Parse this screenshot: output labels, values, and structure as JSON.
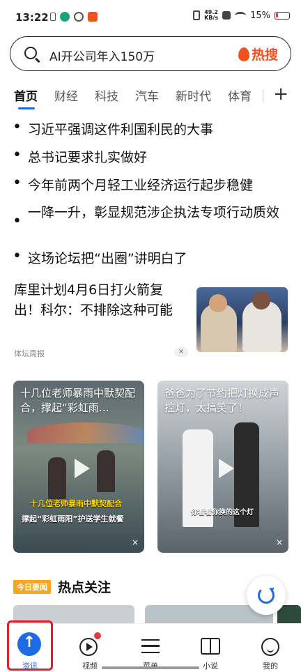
{
  "status_bar": {
    "time": "13:22",
    "network_speed_value": "49.2",
    "network_speed_unit": "KB/s",
    "battery": "15%"
  },
  "search": {
    "query": "AI开公司年入150万",
    "hot_label": "热搜"
  },
  "tabs": [
    "首页",
    "财经",
    "科技",
    "汽车",
    "新时代",
    "体育"
  ],
  "headlines": [
    "习近平强调这件利国利民的大事",
    "总书记要求扎实做好",
    "今年前两个月轻工业经济运行起步稳健",
    "一降一升，彰显规范涉企执法专项行动质效",
    "这场论坛把“出圈”讲明白了"
  ],
  "article": {
    "title": "库里计划4月6日打火箭复出！科尔：不排除这种可能",
    "source": "体坛周报",
    "close": "×"
  },
  "videos": [
    {
      "title": "十几位老师暴雨中默契配合，撑起“彩虹雨…",
      "caption_line1": "十几位老师暴雨中默契配合",
      "caption_line2": "撑起“彩虹雨阳”护送学生就餐",
      "close": "×"
    },
    {
      "title": "爸爸为了节约把灯换成声控灯，太搞笑了！",
      "caption_line1": "你看看你换的这个灯",
      "close": "×"
    }
  ],
  "today_section": {
    "badge": "今日要闻",
    "title": "热点关注"
  },
  "bottom_nav": [
    {
      "label": "资讯",
      "icon": "home-up-arrow-icon",
      "active": true
    },
    {
      "label": "视频",
      "icon": "play-circle-icon",
      "active": false
    },
    {
      "label": "菜单",
      "icon": "menu-icon",
      "active": false
    },
    {
      "label": "小说",
      "icon": "book-icon",
      "active": false
    },
    {
      "label": "我的",
      "icon": "smiley-face-icon",
      "active": false
    }
  ],
  "colors": {
    "accent": "#1e6be6",
    "hot": "#f4511e",
    "highlight": "#e01f2a",
    "badge": "#f5a623"
  }
}
